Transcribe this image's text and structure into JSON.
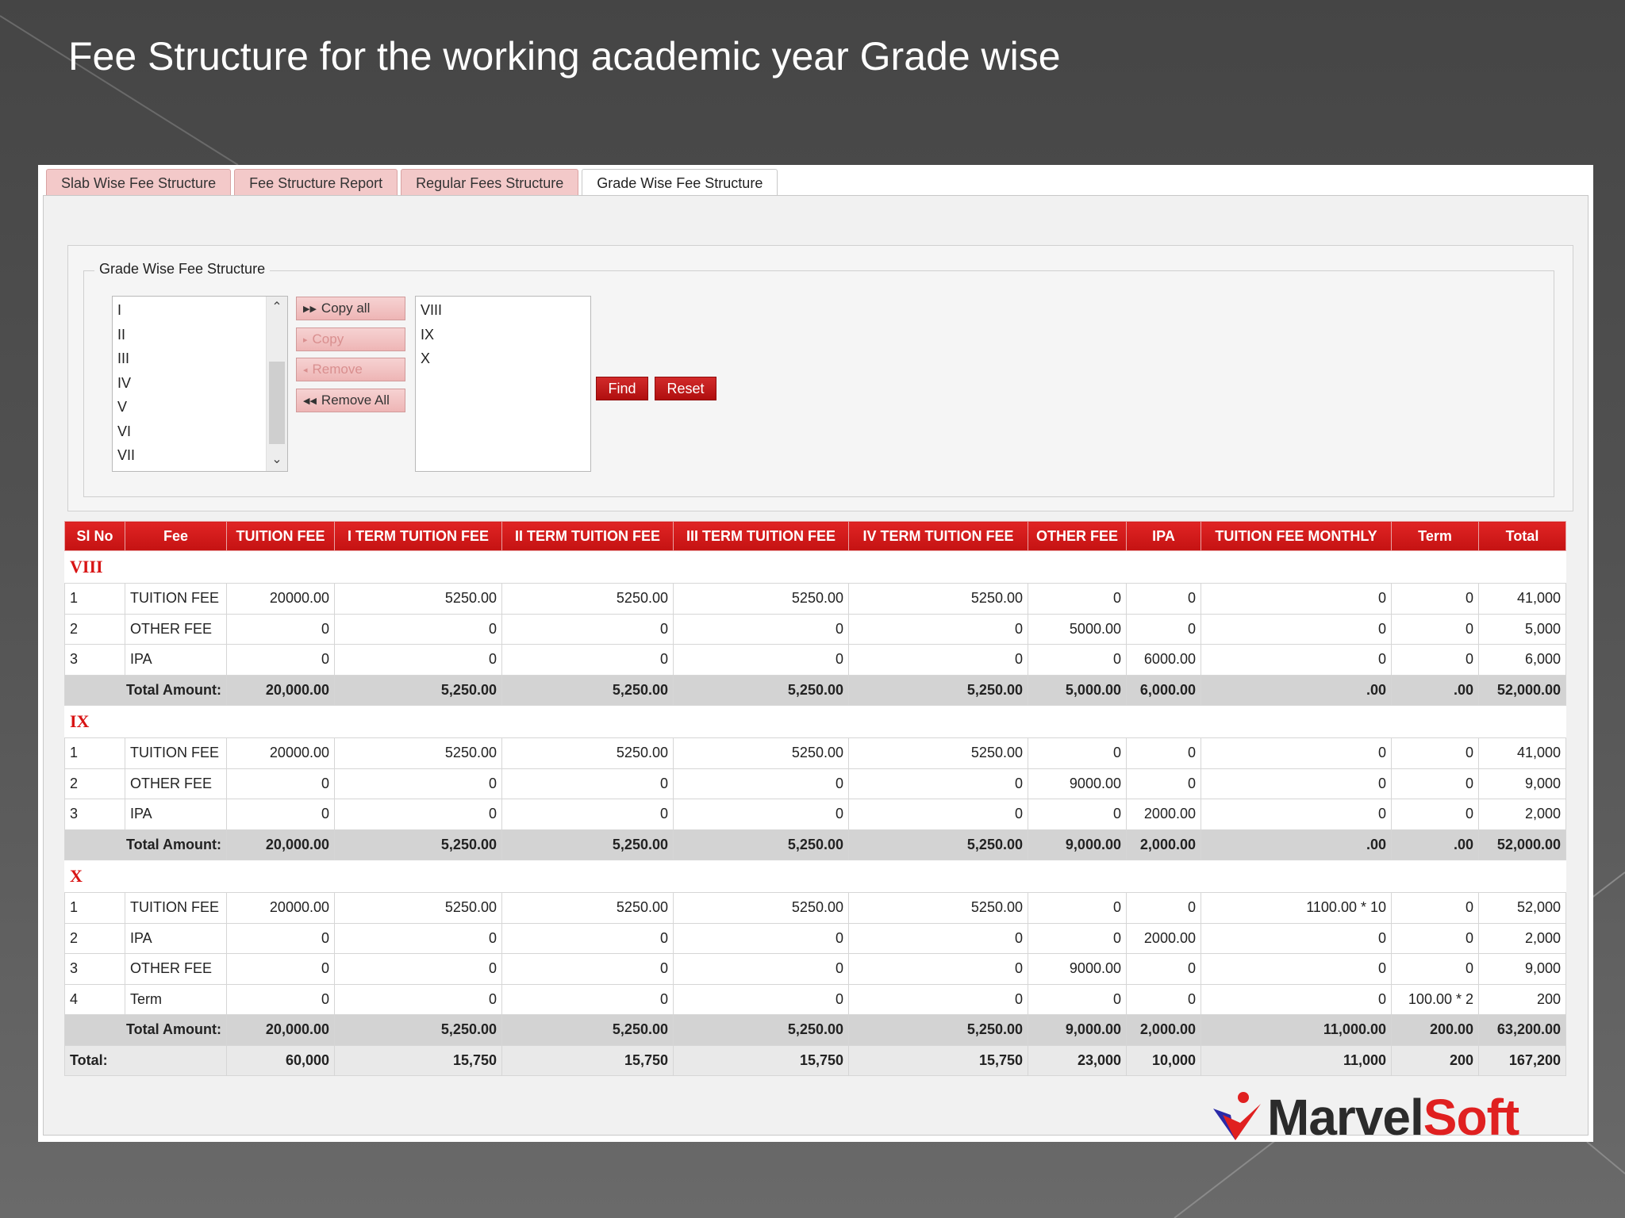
{
  "slide": {
    "title": "Fee Structure for the working academic year Grade wise"
  },
  "colors": {
    "tab_bg": "#f3c9c9",
    "header_red": "#d21a1a",
    "grade_text": "#d81414",
    "logo_dark": "#2b2b2b",
    "logo_red": "#e02020",
    "logo_blue": "#2a2aa8"
  },
  "tabs": [
    {
      "label": "Slab Wise Fee Structure",
      "active": false
    },
    {
      "label": "Fee Structure Report",
      "active": false
    },
    {
      "label": "Regular Fees Structure",
      "active": false
    },
    {
      "label": "Grade Wise Fee Structure",
      "active": true
    }
  ],
  "form": {
    "legend": "Grade Wise Fee Structure",
    "available_grades": [
      "I",
      "II",
      "III",
      "IV",
      "V",
      "VI",
      "VII"
    ],
    "selected_grades": [
      "VIII",
      "IX",
      "X"
    ],
    "buttons": {
      "copy_all": "Copy all",
      "copy": "Copy",
      "remove": "Remove",
      "remove_all": "Remove All",
      "find": "Find",
      "reset": "Reset"
    },
    "icons": {
      "copy_all": "fast-forward-icon",
      "copy": "play-right-icon",
      "remove": "play-left-icon",
      "remove_all": "fast-rewind-icon",
      "scroll_up": "chevron-up-icon",
      "scroll_down": "chevron-down-icon"
    }
  },
  "table": {
    "headers": [
      "Sl No",
      "Fee",
      "TUITION FEE",
      "I TERM TUITION FEE",
      "II TERM TUITION FEE",
      "III TERM TUITION FEE",
      "IV TERM TUITION FEE",
      "OTHER FEE",
      "IPA",
      "TUITION FEE MONTHLY",
      "Term",
      "Total"
    ],
    "groups": [
      {
        "grade": "VIII",
        "rows": [
          [
            "1",
            "TUITION FEE",
            "20000.00",
            "5250.00",
            "5250.00",
            "5250.00",
            "5250.00",
            "0",
            "0",
            "0",
            "0",
            "41,000"
          ],
          [
            "2",
            "OTHER FEE",
            "0",
            "0",
            "0",
            "0",
            "0",
            "5000.00",
            "0",
            "0",
            "0",
            "5,000"
          ],
          [
            "3",
            "IPA",
            "0",
            "0",
            "0",
            "0",
            "0",
            "0",
            "6000.00",
            "0",
            "0",
            "6,000"
          ]
        ],
        "total_label": "Total Amount:",
        "total": [
          "20,000.00",
          "5,250.00",
          "5,250.00",
          "5,250.00",
          "5,250.00",
          "5,000.00",
          "6,000.00",
          ".00",
          ".00",
          "52,000.00"
        ]
      },
      {
        "grade": "IX",
        "rows": [
          [
            "1",
            "TUITION FEE",
            "20000.00",
            "5250.00",
            "5250.00",
            "5250.00",
            "5250.00",
            "0",
            "0",
            "0",
            "0",
            "41,000"
          ],
          [
            "2",
            "OTHER FEE",
            "0",
            "0",
            "0",
            "0",
            "0",
            "9000.00",
            "0",
            "0",
            "0",
            "9,000"
          ],
          [
            "3",
            "IPA",
            "0",
            "0",
            "0",
            "0",
            "0",
            "0",
            "2000.00",
            "0",
            "0",
            "2,000"
          ]
        ],
        "total_label": "Total Amount:",
        "total": [
          "20,000.00",
          "5,250.00",
          "5,250.00",
          "5,250.00",
          "5,250.00",
          "9,000.00",
          "2,000.00",
          ".00",
          ".00",
          "52,000.00"
        ]
      },
      {
        "grade": "X",
        "rows": [
          [
            "1",
            "TUITION FEE",
            "20000.00",
            "5250.00",
            "5250.00",
            "5250.00",
            "5250.00",
            "0",
            "0",
            "1100.00 * 10",
            "0",
            "52,000"
          ],
          [
            "2",
            "IPA",
            "0",
            "0",
            "0",
            "0",
            "0",
            "0",
            "2000.00",
            "0",
            "0",
            "2,000"
          ],
          [
            "3",
            "OTHER FEE",
            "0",
            "0",
            "0",
            "0",
            "0",
            "9000.00",
            "0",
            "0",
            "0",
            "9,000"
          ],
          [
            "4",
            "Term",
            "0",
            "0",
            "0",
            "0",
            "0",
            "0",
            "0",
            "0",
            "100.00 * 2",
            "200"
          ]
        ],
        "total_label": "Total Amount:",
        "total": [
          "20,000.00",
          "5,250.00",
          "5,250.00",
          "5,250.00",
          "5,250.00",
          "9,000.00",
          "2,000.00",
          "11,000.00",
          "200.00",
          "63,200.00"
        ]
      }
    ],
    "grand_total_label": "Total:",
    "grand_total": [
      "60,000",
      "15,750",
      "15,750",
      "15,750",
      "15,750",
      "23,000",
      "10,000",
      "11,000",
      "200",
      "167,200"
    ]
  },
  "logo": {
    "part1": "Marvel",
    "part2": "Soft"
  }
}
